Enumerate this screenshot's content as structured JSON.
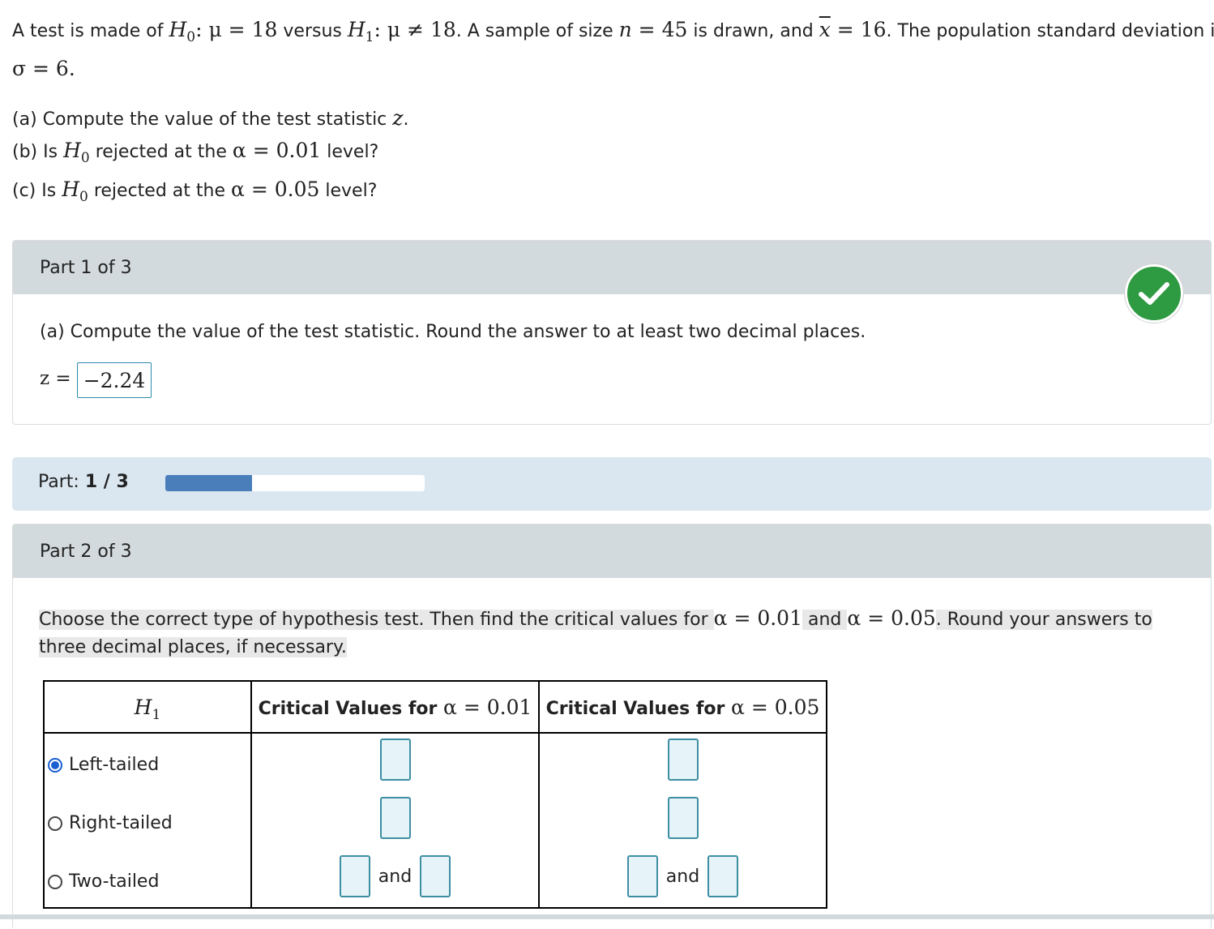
{
  "problem": {
    "t1": "A test is made of ",
    "h": "H",
    "sub0": "0",
    "sub1": "1",
    "h0_rel": ": μ = 18",
    "versus": " versus ",
    "h1_rel": ": μ ≠ 18",
    "t2": ". A sample of size ",
    "n": "n",
    "n_val": " = 45",
    "t3": " is drawn, and ",
    "xbar": "x",
    "xbar_val": " = 16",
    "t4": ". The population standard deviation is",
    "sigma": "σ = 6",
    "period": "."
  },
  "questions": {
    "a_text": "(a) Compute the value of the test statistic ",
    "a_var": "z",
    "a_end": ".",
    "b_pre": "(b) Is ",
    "b_mid": " rejected at the ",
    "b_alpha": "α = 0.01",
    "b_end": " level?",
    "c_pre": "(c) Is ",
    "c_mid": " rejected at the ",
    "c_alpha": "α = 0.05",
    "c_end": " level?"
  },
  "part1": {
    "title": "Part 1 of 3",
    "instruction": "(a) Compute the value of the test statistic. Round the answer to at least two decimal places.",
    "z_label": "z =",
    "z_value": "−2.24",
    "status_icon": "checkmark-icon",
    "status_color": "#2e9a41"
  },
  "progress": {
    "label": "Part: ",
    "value": "1 / 3",
    "fraction": 0.333,
    "color": "#4a7ebb"
  },
  "part2": {
    "title": "Part 2 of 3",
    "instr_1": "Choose the correct type of hypothesis test. Then find the critical values for ",
    "alpha1": "α = 0.01",
    "instr_and": " and ",
    "alpha2": "α = 0.05",
    "instr_2": ". Round your answers to",
    "instr_3": "three decimal places, if necessary.",
    "table": {
      "col1_h": "H",
      "col1_sub": "1",
      "col2_h": "Critical Values for ",
      "col2_alpha": "α = 0.01",
      "col3_h": "Critical Values for ",
      "col3_alpha": "α = 0.05",
      "rows": [
        {
          "label": "Left-tailed",
          "selected": true
        },
        {
          "label": "Right-tailed",
          "selected": false
        },
        {
          "label": "Two-tailed",
          "selected": false
        }
      ],
      "and_text": "and"
    }
  }
}
